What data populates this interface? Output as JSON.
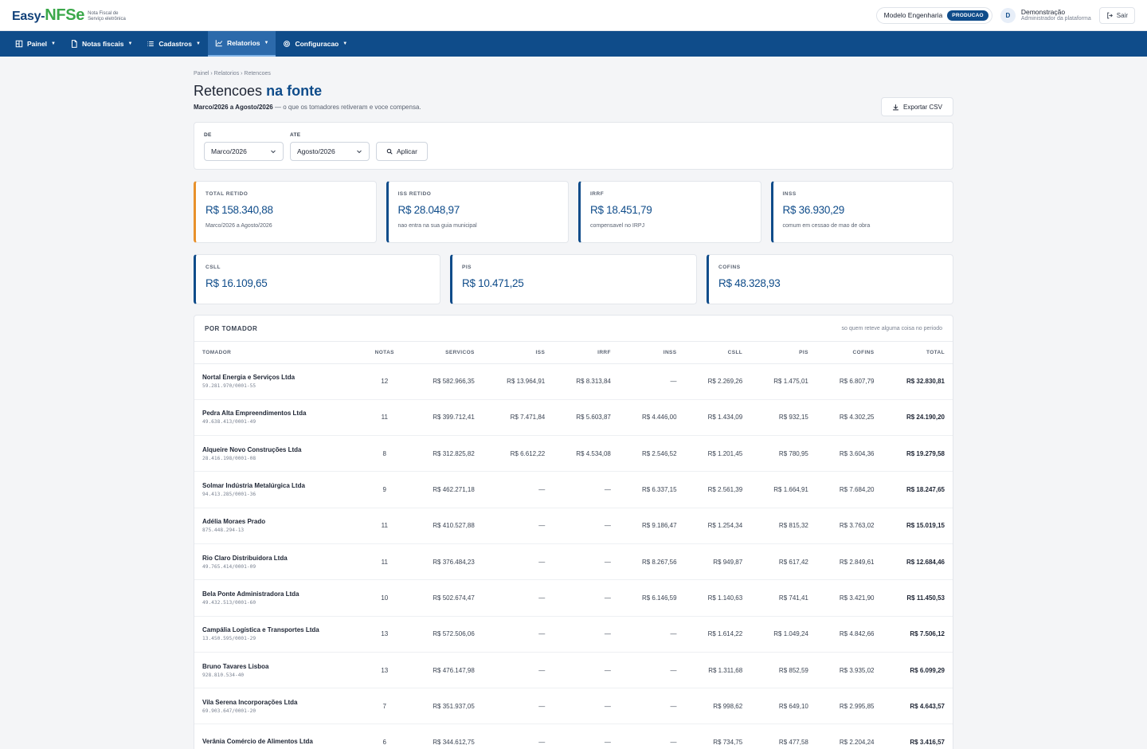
{
  "brand": {
    "name_prefix": "Easy-",
    "name_highlight": "NFSe",
    "tagline_1": "Nota Fiscal de",
    "tagline_2": "Serviço eletrônica"
  },
  "header": {
    "company": "Modelo Engenharia",
    "env_badge": "PRODUCAO",
    "user_initial": "D",
    "user_name": "Demonstração",
    "user_role": "Administrador da plataforma",
    "logout_label": "Sair"
  },
  "nav": {
    "painel": "Painel",
    "notas": "Notas fiscais",
    "cadastros": "Cadastros",
    "relatorios": "Relatorios",
    "configuracao": "Configuracao"
  },
  "breadcrumb": "Painel › Relatorios › Retencoes",
  "page": {
    "title_plain": "Retencoes",
    "title_highlight": "na fonte",
    "period": "Marco/2026 a Agosto/2026",
    "description": "— o que os tomadores retiveram e voce compensa.",
    "export_label": "Exportar CSV"
  },
  "filters": {
    "from_label": "DE",
    "from_value": "Marco/2026",
    "to_label": "ATE",
    "to_value": "Agosto/2026",
    "apply_label": "Aplicar"
  },
  "kpis_top": [
    {
      "label": "TOTAL RETIDO",
      "value": "R$ 158.340,88",
      "sub": "Marco/2026 a Agosto/2026"
    },
    {
      "label": "ISS RETIDO",
      "value": "R$ 28.048,97",
      "sub": "nao entra na sua guia municipal"
    },
    {
      "label": "IRRF",
      "value": "R$ 18.451,79",
      "sub": "compensavel no IRPJ"
    },
    {
      "label": "INSS",
      "value": "R$ 36.930,29",
      "sub": "comum em cessao de mao de obra"
    }
  ],
  "kpis_bottom": [
    {
      "label": "CSLL",
      "value": "R$ 16.109,65"
    },
    {
      "label": "PIS",
      "value": "R$ 10.471,25"
    },
    {
      "label": "COFINS",
      "value": "R$ 48.328,93"
    }
  ],
  "table": {
    "title": "POR TOMADOR",
    "note": "so quem reteve alguma coisa no periodo",
    "columns": [
      "TOMADOR",
      "NOTAS",
      "SERVICOS",
      "ISS",
      "IRRF",
      "INSS",
      "CSLL",
      "PIS",
      "COFINS",
      "TOTAL"
    ],
    "rows": [
      {
        "name": "Nortal Energia e Serviços Ltda",
        "doc": "59.281.970/0001-55",
        "notas": "12",
        "servicos": "R$ 582.966,35",
        "iss": "R$ 13.964,91",
        "irrf": "R$ 8.313,84",
        "inss": "—",
        "csll": "R$ 2.269,26",
        "pis": "R$ 1.475,01",
        "cofins": "R$ 6.807,79",
        "total": "R$ 32.830,81"
      },
      {
        "name": "Pedra Alta Empreendimentos Ltda",
        "doc": "49.638.413/0001-49",
        "notas": "11",
        "servicos": "R$ 399.712,41",
        "iss": "R$ 7.471,84",
        "irrf": "R$ 5.603,87",
        "inss": "R$ 4.446,00",
        "csll": "R$ 1.434,09",
        "pis": "R$ 932,15",
        "cofins": "R$ 4.302,25",
        "total": "R$ 24.190,20"
      },
      {
        "name": "Alqueire Novo Construções Ltda",
        "doc": "28.416.198/0001-08",
        "notas": "8",
        "servicos": "R$ 312.825,82",
        "iss": "R$ 6.612,22",
        "irrf": "R$ 4.534,08",
        "inss": "R$ 2.546,52",
        "csll": "R$ 1.201,45",
        "pis": "R$ 780,95",
        "cofins": "R$ 3.604,36",
        "total": "R$ 19.279,58"
      },
      {
        "name": "Solmar Indústria Metalúrgica Ltda",
        "doc": "94.413.285/0001-36",
        "notas": "9",
        "servicos": "R$ 462.271,18",
        "iss": "—",
        "irrf": "—",
        "inss": "R$ 6.337,15",
        "csll": "R$ 2.561,39",
        "pis": "R$ 1.664,91",
        "cofins": "R$ 7.684,20",
        "total": "R$ 18.247,65"
      },
      {
        "name": "Adélia Moraes Prado",
        "doc": "875.448.294-13",
        "notas": "11",
        "servicos": "R$ 410.527,88",
        "iss": "—",
        "irrf": "—",
        "inss": "R$ 9.186,47",
        "csll": "R$ 1.254,34",
        "pis": "R$ 815,32",
        "cofins": "R$ 3.763,02",
        "total": "R$ 15.019,15"
      },
      {
        "name": "Rio Claro Distribuidora Ltda",
        "doc": "49.765.414/0001-09",
        "notas": "11",
        "servicos": "R$ 376.484,23",
        "iss": "—",
        "irrf": "—",
        "inss": "R$ 8.267,56",
        "csll": "R$ 949,87",
        "pis": "R$ 617,42",
        "cofins": "R$ 2.849,61",
        "total": "R$ 12.684,46"
      },
      {
        "name": "Bela Ponte Administradora Ltda",
        "doc": "49.432.513/0001-60",
        "notas": "10",
        "servicos": "R$ 502.674,47",
        "iss": "—",
        "irrf": "—",
        "inss": "R$ 6.146,59",
        "csll": "R$ 1.140,63",
        "pis": "R$ 741,41",
        "cofins": "R$ 3.421,90",
        "total": "R$ 11.450,53"
      },
      {
        "name": "Campália Logística e Transportes Ltda",
        "doc": "13.450.595/0001-29",
        "notas": "13",
        "servicos": "R$ 572.506,06",
        "iss": "—",
        "irrf": "—",
        "inss": "—",
        "csll": "R$ 1.614,22",
        "pis": "R$ 1.049,24",
        "cofins": "R$ 4.842,66",
        "total": "R$ 7.506,12"
      },
      {
        "name": "Bruno Tavares Lisboa",
        "doc": "928.810.534-40",
        "notas": "13",
        "servicos": "R$ 476.147,98",
        "iss": "—",
        "irrf": "—",
        "inss": "—",
        "csll": "R$ 1.311,68",
        "pis": "R$ 852,59",
        "cofins": "R$ 3.935,02",
        "total": "R$ 6.099,29"
      },
      {
        "name": "Vila Serena Incorporações Ltda",
        "doc": "69.903.647/0001-20",
        "notas": "7",
        "servicos": "R$ 351.937,05",
        "iss": "—",
        "irrf": "—",
        "inss": "—",
        "csll": "R$ 998,62",
        "pis": "R$ 649,10",
        "cofins": "R$ 2.995,85",
        "total": "R$ 4.643,57"
      },
      {
        "name": "Verânia Comércio de Alimentos Ltda",
        "doc": "",
        "notas": "6",
        "servicos": "R$ 344.612,75",
        "iss": "—",
        "irrf": "—",
        "inss": "—",
        "csll": "R$ 734,75",
        "pis": "R$ 477,58",
        "cofins": "R$ 2.204,24",
        "total": "R$ 3.416,57"
      }
    ]
  },
  "colors": {
    "primary": "#0f4c8a",
    "nav_active": "#2c6aab",
    "accent_orange": "#e8912c",
    "brand_green": "#3ba84a"
  }
}
